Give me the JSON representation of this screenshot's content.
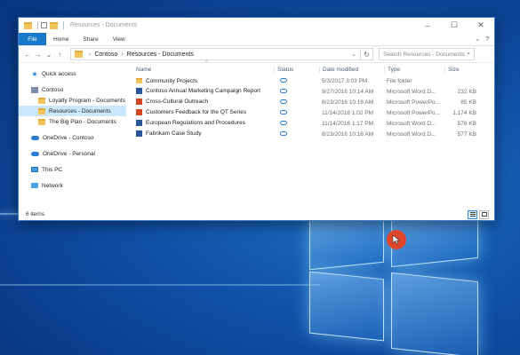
{
  "window": {
    "title": "Resources - Documents",
    "controls": {
      "minimize": "–",
      "maximize": "☐",
      "close": "✕"
    }
  },
  "ribbon": {
    "tabs": [
      "File",
      "Home",
      "Share",
      "View"
    ],
    "expand": "⌄",
    "help": "?"
  },
  "address_bar": {
    "back": "←",
    "forward": "→",
    "recent": "⌄",
    "up": "↑",
    "path": [
      "Contoso",
      "Resources - Documents"
    ],
    "separator": "›",
    "refresh": "↻",
    "search_placeholder": "Search Resources - Documents",
    "search_icon": "⌕"
  },
  "nav_pane": {
    "items": [
      {
        "label": "Quick access",
        "icon": "star-icon"
      },
      {
        "label": "Contoso",
        "icon": "building-icon"
      },
      {
        "label": "Loyalty Program - Documents",
        "icon": "folder-icon"
      },
      {
        "label": "Resources - Documents",
        "icon": "folder-icon",
        "selected": true
      },
      {
        "label": "The Big Plan - Documents",
        "icon": "folder-icon"
      },
      {
        "label": "OneDrive - Contoso",
        "icon": "cloud-icon"
      },
      {
        "label": "OneDrive - Personal",
        "icon": "cloud-icon"
      },
      {
        "label": "This PC",
        "icon": "computer-icon"
      },
      {
        "label": "Network",
        "icon": "network-icon"
      }
    ]
  },
  "file_list": {
    "sort_indicator": "^",
    "columns": [
      "Name",
      "Status",
      "Date modified",
      "Type",
      "Size"
    ],
    "rows": [
      {
        "name": "Community Projects",
        "icon": "folder-icon",
        "date": "5/3/2017 3:03 PM",
        "type": "File folder",
        "size": ""
      },
      {
        "name": "Contoso Annual Marketing Campaign Report",
        "icon": "word-icon",
        "date": "9/27/2016 10:14 AM",
        "type": "Microsoft Word D...",
        "size": "232 KB"
      },
      {
        "name": "Cross-Cultural Outreach",
        "icon": "powerpoint-icon",
        "date": "8/23/2016 10:16 AM",
        "type": "Microsoft PowerPo...",
        "size": "85 KB"
      },
      {
        "name": "Customers Feedback for the QT Series",
        "icon": "powerpoint-icon",
        "date": "11/14/2016 1:02 PM",
        "type": "Microsoft PowerPo...",
        "size": "1,174 KB"
      },
      {
        "name": "European Regulations and Procedures",
        "icon": "word-icon",
        "date": "11/14/2016 1:17 PM",
        "type": "Microsoft Word D...",
        "size": "578 KB"
      },
      {
        "name": "Fabrikam Case Study",
        "icon": "word-icon",
        "date": "8/23/2016 10:16 AM",
        "type": "Microsoft Word D...",
        "size": "577 KB"
      }
    ]
  },
  "status_bar": {
    "item_count": "6 items"
  },
  "colors": {
    "accent": "#1979ca",
    "selection": "#cce8ff",
    "cursor_marker": "#e0462c"
  }
}
